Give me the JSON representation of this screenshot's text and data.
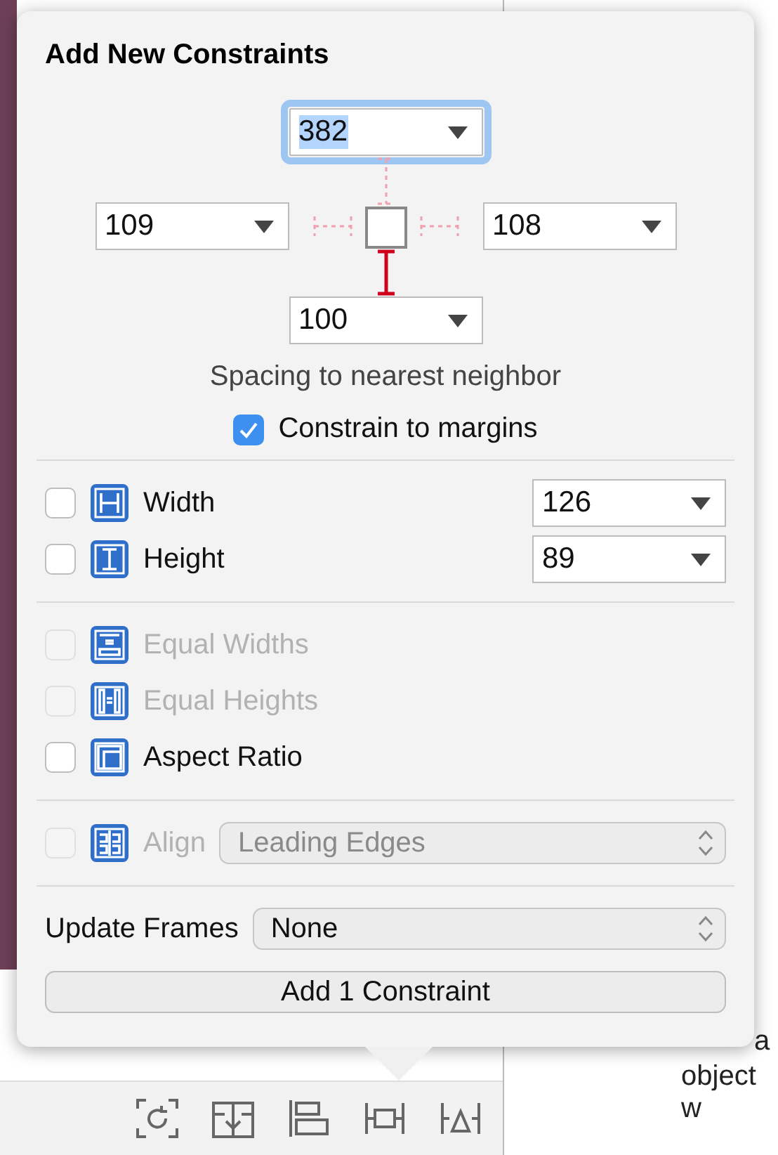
{
  "popover": {
    "title": "Add New Constraints",
    "spacing": {
      "top": {
        "value": "382",
        "focused": true,
        "active": false
      },
      "left": {
        "value": "109",
        "focused": false,
        "active": false
      },
      "right": {
        "value": "108",
        "focused": false,
        "active": false
      },
      "bottom": {
        "value": "100",
        "focused": false,
        "active": true
      },
      "caption": "Spacing to nearest neighbor"
    },
    "constrain_to_margins": {
      "label": "Constrain to margins",
      "checked": true
    },
    "size_rows": [
      {
        "kind": "width",
        "label": "Width",
        "checked": false,
        "disabled": false,
        "value": "126"
      },
      {
        "kind": "height",
        "label": "Height",
        "checked": false,
        "disabled": false,
        "value": "89"
      }
    ],
    "relation_rows": [
      {
        "kind": "equal-widths",
        "label": "Equal Widths",
        "checked": false,
        "disabled": true
      },
      {
        "kind": "equal-heights",
        "label": "Equal Heights",
        "checked": false,
        "disabled": true
      },
      {
        "kind": "aspect",
        "label": "Aspect Ratio",
        "checked": false,
        "disabled": false
      }
    ],
    "align": {
      "kind": "align",
      "label": "Align",
      "checked": false,
      "disabled": true,
      "value": "Leading Edges"
    },
    "update_frames": {
      "label": "Update Frames",
      "value": "None"
    },
    "button": "Add 1 Constraint"
  },
  "inspector": {
    "texts": [
      "a",
      "object w"
    ]
  }
}
